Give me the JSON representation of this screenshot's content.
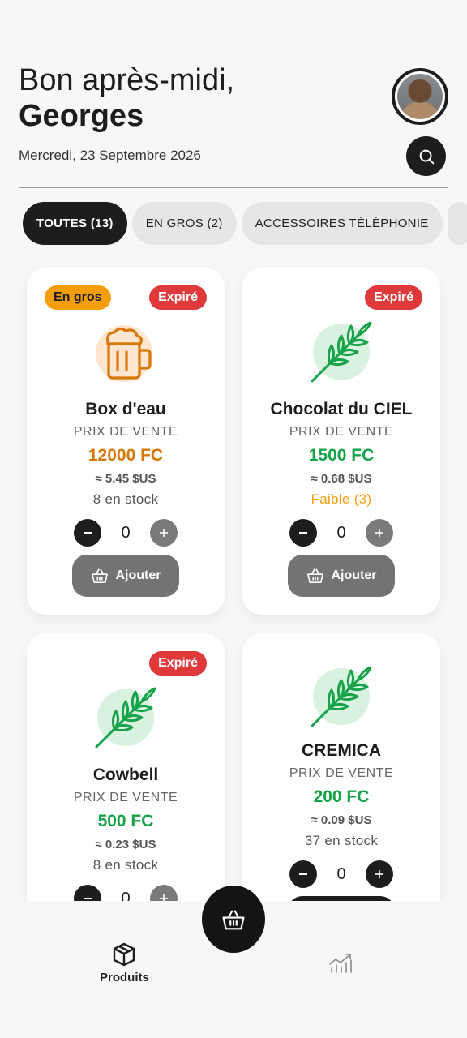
{
  "header": {
    "greeting": "Bon après-midi,",
    "username": "Georges",
    "date": "Mercredi, 23 Septembre 2026"
  },
  "tabs": [
    {
      "label": "TOUTES (13)",
      "active": true
    },
    {
      "label": "EN GROS (2)",
      "active": false
    },
    {
      "label": "ACCESSOIRES TÉLÉPHONIE",
      "active": false
    }
  ],
  "products": [
    {
      "badge_gros": "En gros",
      "badge_expired": "Expiré",
      "icon": "beer-mug-icon",
      "name": "Box d'eau",
      "price_label": "PRIX DE VENTE",
      "price": "12000 FC",
      "usd": "≈ 5.45 $US",
      "stock": "8 en stock",
      "quantity": "0",
      "add_label": "Ajouter"
    },
    {
      "badge_expired": "Expiré",
      "icon": "wheat-icon",
      "name": "Chocolat du CIEL",
      "price_label": "PRIX DE VENTE",
      "price": "1500 FC",
      "usd": "≈ 0.68 $US",
      "stock": "Faible (3)",
      "quantity": "0",
      "add_label": "Ajouter"
    },
    {
      "badge_expired": "Expiré",
      "icon": "wheat-icon",
      "name": "Cowbell",
      "price_label": "PRIX DE VENTE",
      "price": "500 FC",
      "usd": "≈ 0.23 $US",
      "stock": "8 en stock",
      "quantity": "0"
    },
    {
      "icon": "wheat-icon",
      "name": "CREMICA",
      "price_label": "PRIX DE VENTE",
      "price": "200 FC",
      "usd": "≈ 0.09 $US",
      "stock": "37 en stock",
      "quantity": "0"
    }
  ],
  "nav": {
    "products_label": "Produits"
  },
  "colors": {
    "accent_dark": "#1d1d1d",
    "expired": "#e0393b",
    "wholesale": "#f59e0b",
    "price_orange": "#d97706",
    "price_green": "#16a34a"
  }
}
